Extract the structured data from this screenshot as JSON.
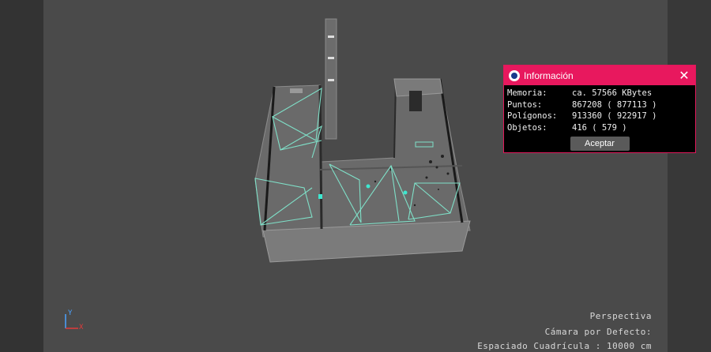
{
  "viewport": {
    "view_name": "Perspectiva",
    "camera": "Cámara por Defecto:",
    "grid_spacing": "Espaciado Cuadrícula : 10000 cm",
    "axis_labels": {
      "y": "Y",
      "x": "X"
    }
  },
  "info_dialog": {
    "title": "Información",
    "app_icon": "cinema4d-logo-icon",
    "close_icon": "close-icon",
    "rows": [
      {
        "label": "Memoria:",
        "value": "ca. 57566 KBytes"
      },
      {
        "label": "Puntos:",
        "value": "867208 ( 877113 )"
      },
      {
        "label": "Polígonos:",
        "value": "913360 ( 922917 )"
      },
      {
        "label": "Objetos:",
        "value": "416 ( 579 )"
      }
    ],
    "accept_label": "Aceptar"
  },
  "colors": {
    "accent": "#e8185e",
    "viewport_bg": "#4a4a4a",
    "wireframe": "#7fe0c8"
  }
}
